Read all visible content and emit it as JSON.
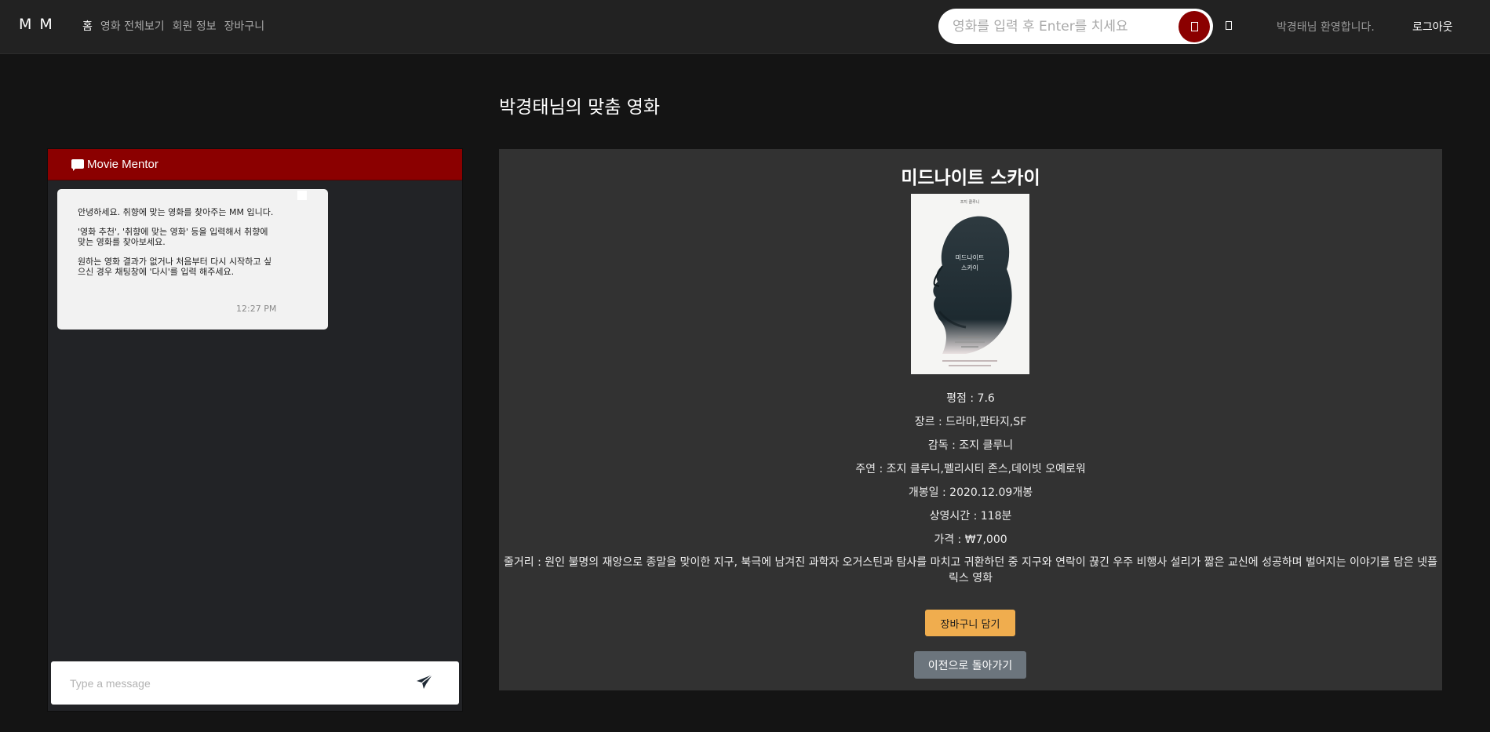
{
  "navbar": {
    "brand": "M M",
    "links": [
      {
        "label": "홈"
      },
      {
        "label": "영화 전체보기"
      },
      {
        "label": "회원 정보"
      },
      {
        "label": "장바구니"
      }
    ],
    "search": {
      "placeholder": "영화를 입력 후 Enter를 치세요"
    },
    "search_button_icon": "search-icon",
    "mic_icon": "mic-icon",
    "welcome_text": "박경태님 환영합니다.",
    "logout_label": "로그아웃"
  },
  "page": {
    "heading": "박경태님의 맞춤 영화"
  },
  "chat": {
    "title": "Movie Mentor",
    "header_icon": "comment-icon",
    "message": {
      "paragraphs": [
        "안녕하세요. 취향에 맞는 영화를 찾아주는 MM 입니다.",
        "'영화 추천', '취향에 맞는 영화' 등을 입력해서 취향에 맞는 영화를 찾아보세요.",
        "원하는 영화 결과가 없거나 처음부터 다시 시작하고 싶으신 경우 채팅창에 '다시'를 입력 해주세요."
      ],
      "time": "12:27 PM"
    },
    "input_placeholder": "Type a message",
    "send_icon": "send-icon"
  },
  "movie": {
    "title": "미드나이트 스카이",
    "poster": {
      "top_text": "조지 클루니",
      "center_text": [
        "미드나이트",
        "스카이"
      ]
    },
    "rating": "평점 : 7.6",
    "genre": "장르 : 드라마,판타지,SF",
    "director": "감독 : 조지 클루니",
    "cast": "주연 : 조지 클루니,펠리시티 존스,데이빗 오예로워",
    "release": "개봉일 : 2020.12.09개봉",
    "runtime": "상영시간 : 118분",
    "price": "가격 : ₩7,000",
    "synopsis": "줄거리 : 원인 불명의 재앙으로 종말을 맞이한 지구, 북극에 남겨진 과학자 오거스틴과 탐사를 마치고 귀환하던 중 지구와 연락이 끊긴 우주 비행사 설리가 짧은 교신에 성공하며 벌어지는 이야기를 담은 넷플릭스 영화",
    "cart_button": "장바구니 담기",
    "back_button": "이전으로 돌아가기"
  },
  "colors": {
    "accent": "#8b0000",
    "page_background": "#141414",
    "navbar": "#222222",
    "panel": "#323232",
    "cart_button": "#f0ad4e",
    "back_button": "#6c757d"
  }
}
